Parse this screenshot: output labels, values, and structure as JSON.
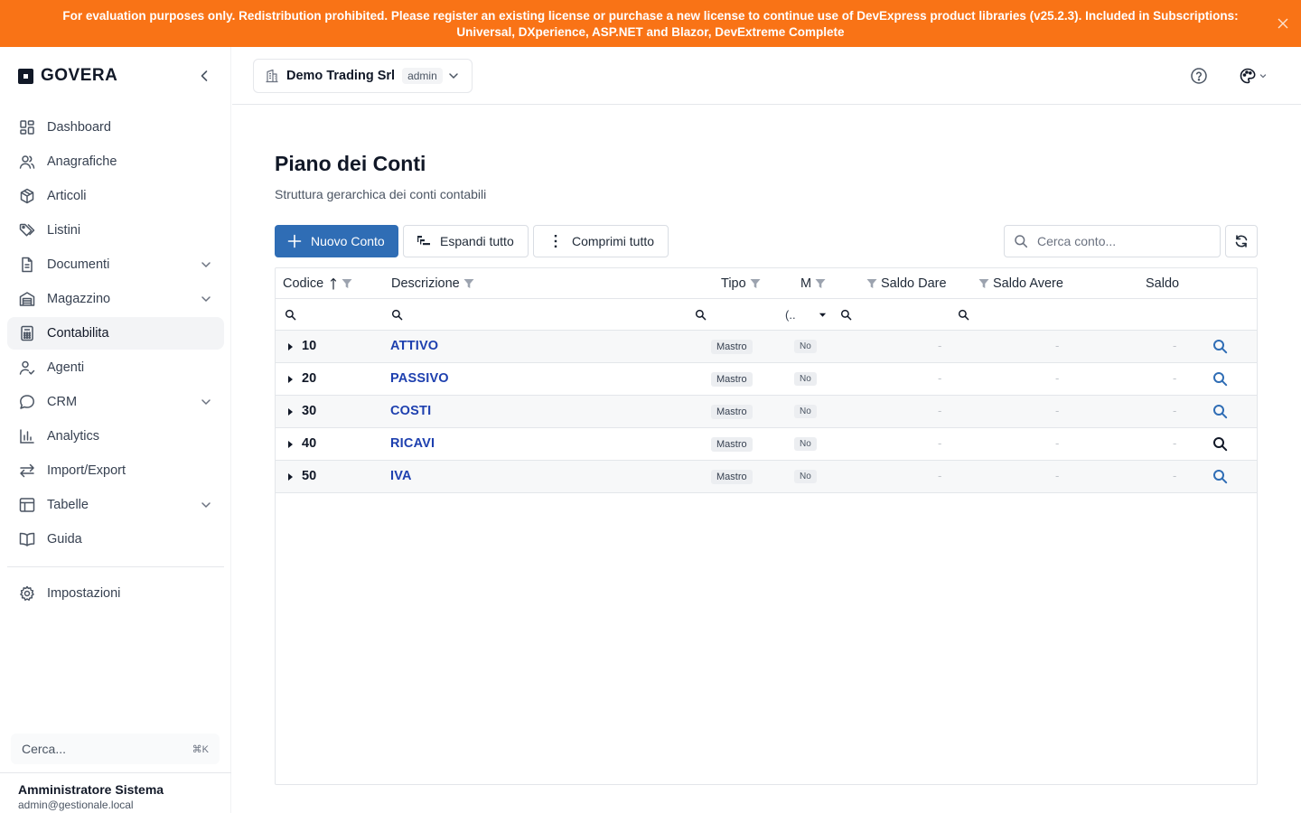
{
  "banner": {
    "text": "For evaluation purposes only. Redistribution prohibited. Please register an existing license or purchase a new license to continue use of DevExpress product libraries (v25.2.3). Included in Subscriptions: Universal, DXperience, ASP.NET and Blazor, DevExtreme Complete",
    "color": "#f97316"
  },
  "brand": {
    "name": "GOVERA"
  },
  "nav": {
    "items": [
      {
        "label": "Dashboard",
        "icon": "dashboard-icon"
      },
      {
        "label": "Anagrafiche",
        "icon": "users-icon"
      },
      {
        "label": "Articoli",
        "icon": "package-icon"
      },
      {
        "label": "Listini",
        "icon": "tags-icon"
      },
      {
        "label": "Documenti",
        "icon": "document-icon",
        "expandable": true
      },
      {
        "label": "Magazzino",
        "icon": "warehouse-icon",
        "expandable": true
      },
      {
        "label": "Contabilita",
        "icon": "calculator-icon",
        "active": true
      },
      {
        "label": "Agenti",
        "icon": "user-check-icon"
      },
      {
        "label": "CRM",
        "icon": "chat-icon",
        "expandable": true
      },
      {
        "label": "Analytics",
        "icon": "bar-chart-icon"
      },
      {
        "label": "Import/Export",
        "icon": "arrows-icon"
      },
      {
        "label": "Tabelle",
        "icon": "table-icon",
        "expandable": true
      },
      {
        "label": "Guida",
        "icon": "book-icon"
      }
    ],
    "settings": {
      "label": "Impostazioni",
      "icon": "gear-icon"
    }
  },
  "sidebar_search": {
    "placeholder": "Cerca...",
    "shortcut": "⌘K"
  },
  "user": {
    "name": "Amministratore Sistema",
    "email": "admin@gestionale.local"
  },
  "company": {
    "name": "Demo Trading Srl",
    "role": "admin"
  },
  "page": {
    "title": "Piano dei Conti",
    "subtitle": "Struttura gerarchica dei conti contabili"
  },
  "toolbar": {
    "new_label": "Nuovo Conto",
    "expand_label": "Espandi tutto",
    "collapse_label": "Comprimi tutto",
    "search_placeholder": "Cerca conto...",
    "accent": "#2f6db5"
  },
  "grid": {
    "columns": {
      "code": "Codice",
      "description": "Descrizione",
      "type": "Tipo",
      "m": "M",
      "saldo_dare": "Saldo Dare",
      "saldo_avere": "Saldo Avere",
      "saldo": "Saldo"
    },
    "m_filter_value": "(..",
    "rows": [
      {
        "code": "10",
        "description": "ATTIVO",
        "type": "Mastro",
        "m": "No",
        "dare": "-",
        "avere": "-",
        "saldo": "-"
      },
      {
        "code": "20",
        "description": "PASSIVO",
        "type": "Mastro",
        "m": "No",
        "dare": "-",
        "avere": "-",
        "saldo": "-"
      },
      {
        "code": "30",
        "description": "COSTI",
        "type": "Mastro",
        "m": "No",
        "dare": "-",
        "avere": "-",
        "saldo": "-"
      },
      {
        "code": "40",
        "description": "RICAVI",
        "type": "Mastro",
        "m": "No",
        "dare": "-",
        "avere": "-",
        "saldo": "-"
      },
      {
        "code": "50",
        "description": "IVA",
        "type": "Mastro",
        "m": "No",
        "dare": "-",
        "avere": "-",
        "saldo": "-"
      }
    ]
  }
}
